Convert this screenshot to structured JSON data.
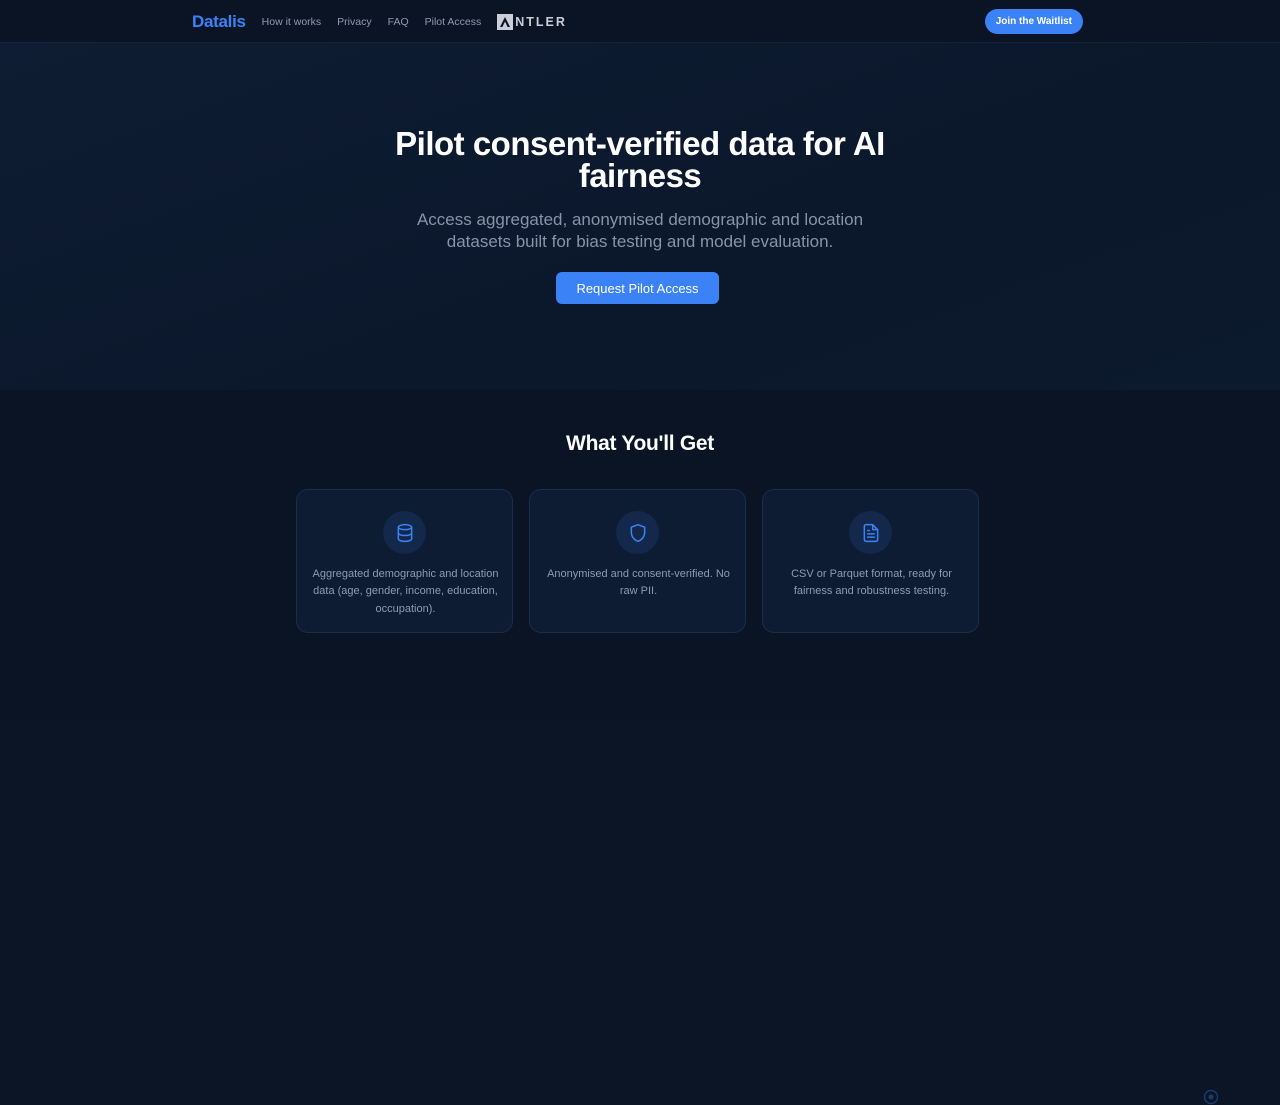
{
  "nav": {
    "brand": "Datalis",
    "links": [
      "How it works",
      "Privacy",
      "FAQ",
      "Pilot Access"
    ],
    "partner_logo_icon": "antler-logo-icon",
    "partner_logo_text": "NTLER",
    "cta_label": "Join the Waitlist"
  },
  "hero": {
    "title": "Pilot consent-verified data for AI fairness",
    "subtitle": "Access aggregated, anonymised demographic and location datasets built for bias testing and model evaluation.",
    "cta_label": "Request Pilot Access"
  },
  "features": {
    "title": "What You'll Get",
    "cards": [
      {
        "icon": "database-icon",
        "text": "Aggregated demographic and location data (age, gender, income, education, occupation)."
      },
      {
        "icon": "shield-icon",
        "text": "Anonymised and consent-verified. No raw PII."
      },
      {
        "icon": "document-icon",
        "text": "CSV or Parquet format, ready for fairness and robustness testing."
      }
    ]
  },
  "colors": {
    "accent": "#3b82f6",
    "background": "#0b1526",
    "card_background": "#0d1b33"
  }
}
